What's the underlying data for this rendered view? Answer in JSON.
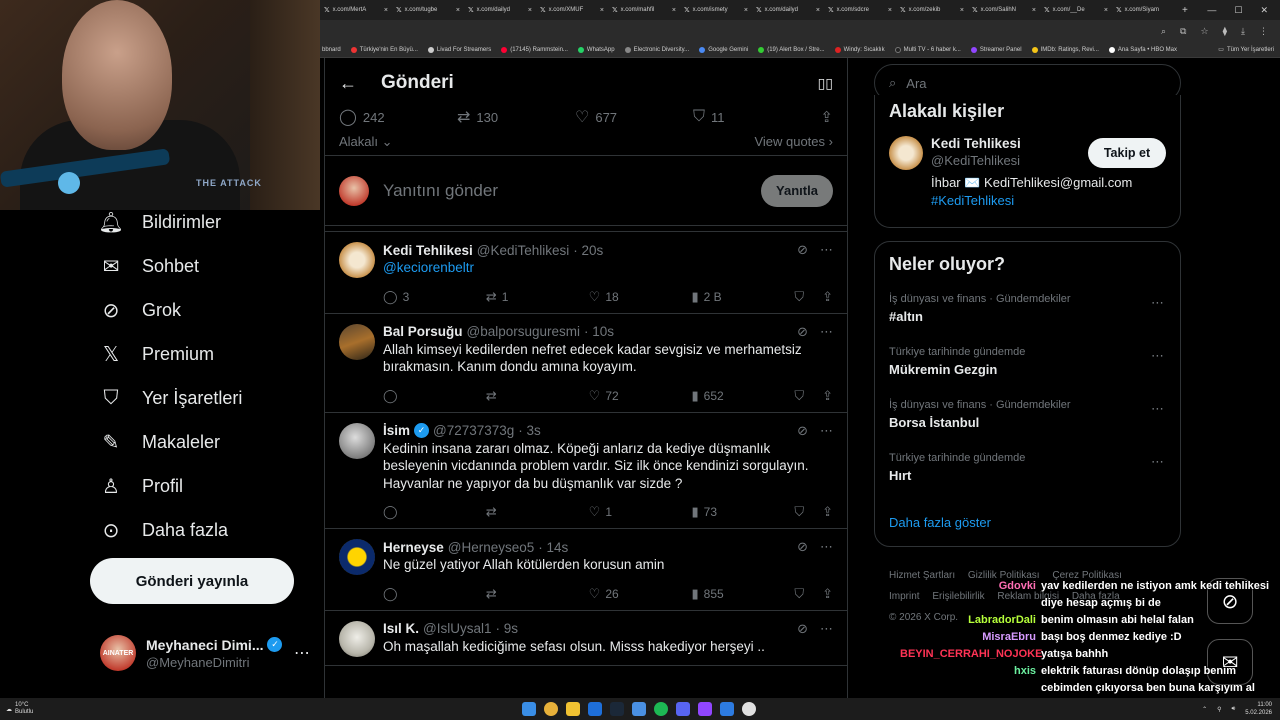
{
  "browser": {
    "tabs": [
      "x.com/MertA",
      "x.com/tugbe",
      "x.com/dailyd",
      "x.com/XMUF",
      "x.com/mahfil",
      "x.com/ismety",
      "x.com/dailyd",
      "x.com/sdcre",
      "x.com/zekib",
      "x.com/SalihN",
      "x.com/__De",
      "x.com/Siyam"
    ],
    "tab_close": "×",
    "new_tab": "+",
    "bookmarks": [
      "bbnard",
      "Türkiye'nin En Büyü...",
      "Livad For Streamers",
      "(17145) Rammstein...",
      "WhatsApp",
      "Electronic Diversity...",
      "Google Gemini",
      "(19) Alert Box / Stre...",
      "Windy: Sıcaklık",
      "Multi TV - 6 haber k...",
      "Streamer Panel",
      "IMDb: Ratings, Revi...",
      "Ana Sayfa • HBO Max"
    ],
    "bookmarks_right": "Tüm Yer İşaretleri"
  },
  "webcam": {
    "logo_text": "THE ATTACK"
  },
  "nav": {
    "items": [
      {
        "label": "Bildirimler",
        "icon": "bell-icon"
      },
      {
        "label": "Sohbet",
        "icon": "mail-icon"
      },
      {
        "label": "Grok",
        "icon": "grok-icon"
      },
      {
        "label": "Premium",
        "icon": "x-logo-icon"
      },
      {
        "label": "Yer İşaretleri",
        "icon": "bookmark-icon"
      },
      {
        "label": "Makaleler",
        "icon": "article-icon"
      },
      {
        "label": "Profil",
        "icon": "person-icon"
      },
      {
        "label": "Daha fazla",
        "icon": "more-circle-icon"
      }
    ],
    "post_button": "Gönderi yayınla",
    "account": {
      "name": "Meyhaneci Dimi...",
      "handle": "@MeyhaneDimitri",
      "avatar_text": "AINATER"
    }
  },
  "main": {
    "title": "Gönderi",
    "stats": {
      "replies": "242",
      "reposts": "130",
      "likes": "677",
      "bookmarks": "11"
    },
    "sort_label": "Alakalı",
    "view_quotes": "View quotes",
    "reply_placeholder": "Yanıtını gönder",
    "reply_button": "Yanıtla",
    "tweets": [
      {
        "name": "Kedi Tehlikesi",
        "handle": "@KediTehlikesi",
        "time": "· 20s",
        "verified": false,
        "text": "@keciorenbeltr",
        "is_link": true,
        "replies": "3",
        "reposts": "1",
        "likes": "18",
        "views": "2 B"
      },
      {
        "name": "Bal Porsuğu",
        "handle": "@balporsuguresmi",
        "time": "· 10s",
        "verified": false,
        "text": "Allah kimseyi kedilerden nefret edecek kadar sevgisiz ve merhametsiz bırakmasın. Kanım dondu amına koyayım.",
        "is_link": false,
        "replies": "",
        "reposts": "",
        "likes": "72",
        "views": "652"
      },
      {
        "name": "İsim",
        "handle": "@72737373g",
        "time": "· 3s",
        "verified": true,
        "text": "Kedinin insana zararı olmaz. Köpeği anlarız da kediye düşmanlık besleyenin vicdanında problem vardır. Siz ilk önce kendinizi sorgulayın. Hayvanlar ne yapıyor da bu düşmanlık var sizde ?",
        "is_link": false,
        "replies": "",
        "reposts": "",
        "likes": "1",
        "views": "73"
      },
      {
        "name": "Herneyse",
        "handle": "@Herneyseo5",
        "time": "· 14s",
        "verified": false,
        "text": "Ne güzel yatiyor Allah kötülerden korusun amin",
        "is_link": false,
        "replies": "",
        "reposts": "",
        "likes": "26",
        "views": "855"
      },
      {
        "name": "Isıl K.",
        "handle": "@IslUysal1",
        "time": "· 9s",
        "verified": false,
        "text": "Oh maşallah kediciğime sefası olsun. Misss hakediyor herşeyi ..",
        "is_link": false,
        "replies": "",
        "reposts": "",
        "likes": "",
        "views": ""
      }
    ]
  },
  "sidebar": {
    "search_placeholder": "Ara",
    "related_title": "Alakalı kişiler",
    "related": {
      "name": "Kedi Tehlikesi",
      "handle": "@KediTehlikesi",
      "follow": "Takip et",
      "bio": "İhbar ✉️ KediTehlikesi@gmail.com",
      "bio_tag": "#KediTehlikesi"
    },
    "trends_title": "Neler oluyor?",
    "trends": [
      {
        "meta": "İş dünyası ve finans · Gündemdekiler",
        "name": "#altın"
      },
      {
        "meta": "Türkiye tarihinde gündemde",
        "name": "Mükremin Gezgin"
      },
      {
        "meta": "İş dünyası ve finans · Gündemdekiler",
        "name": "Borsa İstanbul"
      },
      {
        "meta": "Türkiye tarihinde gündemde",
        "name": "Hırt"
      }
    ],
    "show_more": "Daha fazla göster",
    "footer": [
      "Hizmet Şartları",
      "Gizlilik Politikası",
      "Çerez Politikası",
      "Imprint",
      "Erişilebilirlik",
      "Reklam bilgisi",
      "Daha fazla",
      "© 2026 X Corp."
    ]
  },
  "chat": [
    {
      "user": "Gdovki",
      "color": "#ff6fb5",
      "msg": "yav kedilerden ne istiyon amk kedi tehlikesi diye hesap açmış bi de"
    },
    {
      "user": "LabradorDali",
      "color": "#b6ff3b",
      "msg": "benim olmasın abi helal falan"
    },
    {
      "user": "MisraEbru",
      "color": "#d79bff",
      "msg": "başı boş denmez kediye :D"
    },
    {
      "user": "BEYIN_CERRAHI_NOJOKE",
      "color": "#ff3355",
      "msg": "yatışa bahhh"
    },
    {
      "user": "hxis",
      "color": "#6cf0a0",
      "msg": "elektrik faturası dönüp dolaşıp benim cebimden çıkıyorsa ben buna karşıyım al evine besle orada"
    }
  ],
  "taskbar": {
    "temp": "10°C",
    "weather": "Bulutlu",
    "time": "11:00",
    "date": "5.02.2026"
  }
}
